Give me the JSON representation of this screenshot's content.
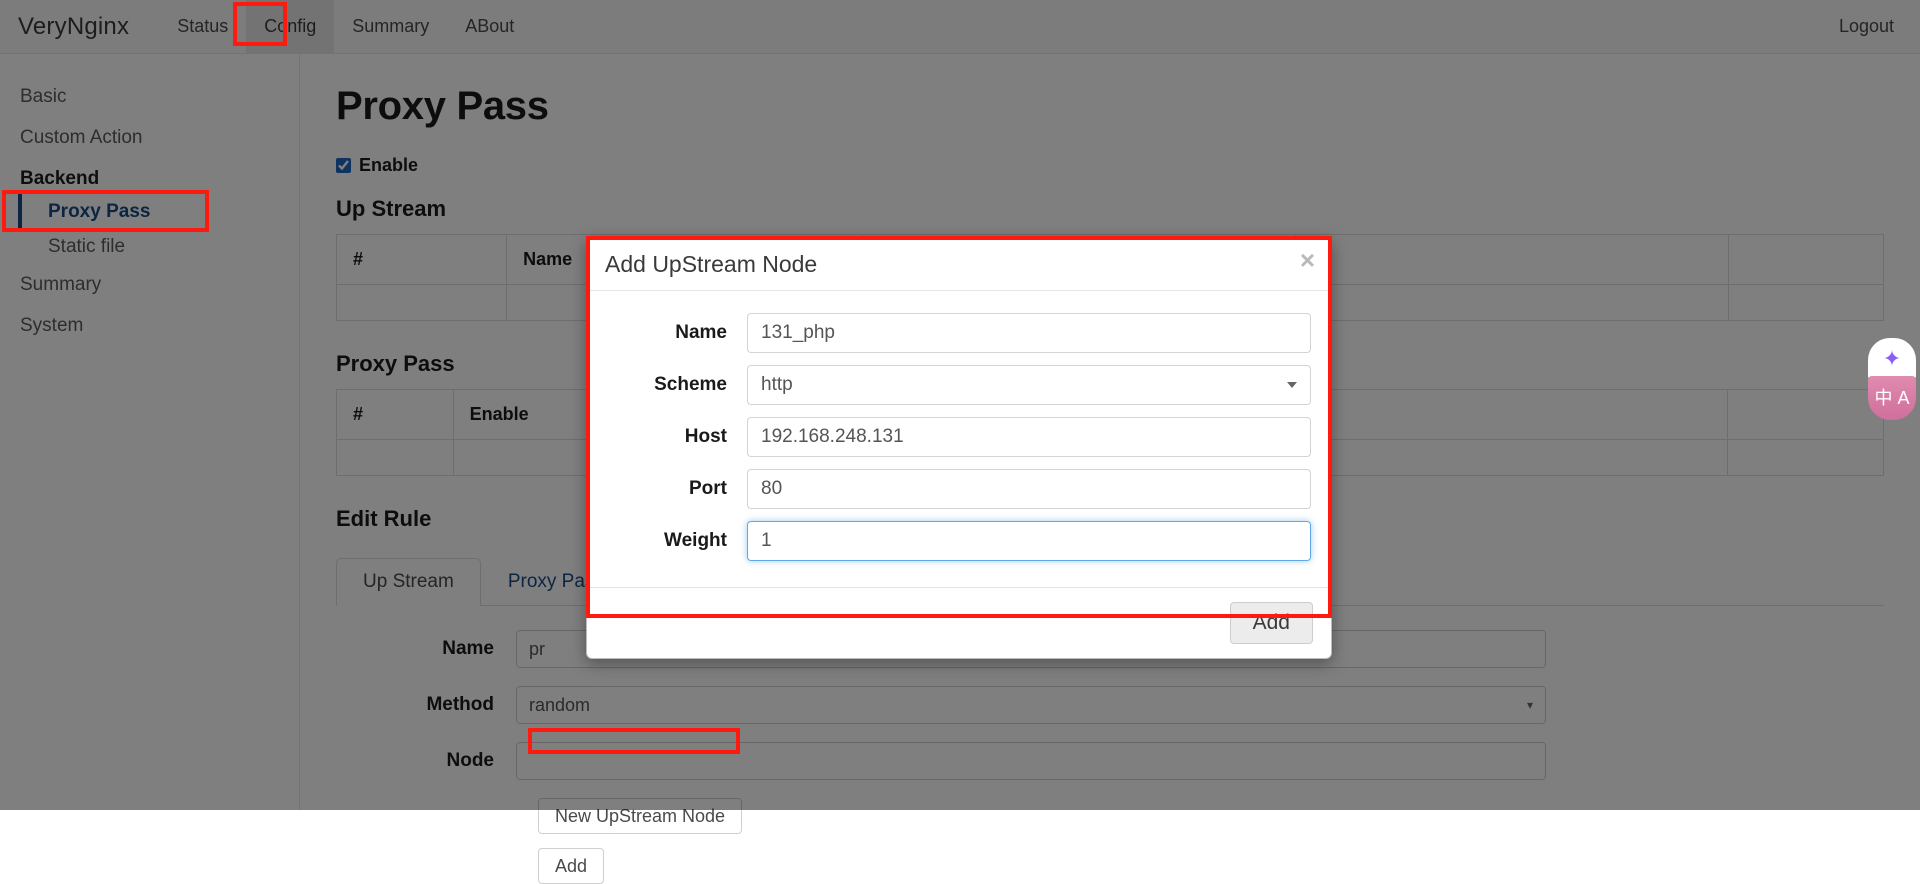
{
  "navbar": {
    "brand": "VeryNginx",
    "links": [
      {
        "label": "Status",
        "active": false
      },
      {
        "label": "Config",
        "active": true
      },
      {
        "label": "Summary",
        "active": false
      },
      {
        "label": "ABout",
        "active": false
      }
    ],
    "logout": "Logout"
  },
  "sidebar": {
    "items": [
      {
        "label": "Basic",
        "type": "item"
      },
      {
        "label": "Custom Action",
        "type": "item"
      },
      {
        "label": "Backend",
        "type": "group"
      },
      {
        "label": "Proxy Pass",
        "type": "sub",
        "current": true
      },
      {
        "label": "Static file",
        "type": "sub",
        "current": false
      },
      {
        "label": "Summary",
        "type": "item"
      },
      {
        "label": "System",
        "type": "item"
      }
    ]
  },
  "main": {
    "title": "Proxy Pass",
    "enable_label": "Enable",
    "enable_checked": true,
    "upstream_section": {
      "heading": "Up Stream",
      "columns": [
        "#",
        "Name",
        "",
        "",
        ""
      ]
    },
    "proxypass_section": {
      "heading": "Proxy Pass",
      "columns": [
        "#",
        "Enable",
        "",
        "",
        ""
      ]
    },
    "editrule_heading": "Edit Rule",
    "tabs": [
      {
        "label": "Up Stream",
        "active": true
      },
      {
        "label": "Proxy Pass",
        "active": false
      }
    ],
    "form": {
      "name_label": "Name",
      "name_value": "pr",
      "method_label": "Method",
      "method_value": "random",
      "node_label": "Node",
      "node_value": "",
      "new_node_button": "New UpStream Node",
      "add_button": "Add"
    }
  },
  "modal": {
    "title": "Add UpStream Node",
    "close_glyph": "×",
    "fields": [
      {
        "label": "Name",
        "value": "131_php",
        "type": "text",
        "focused": false
      },
      {
        "label": "Scheme",
        "value": "http",
        "type": "select",
        "focused": false
      },
      {
        "label": "Host",
        "value": "192.168.248.131",
        "type": "text",
        "focused": false
      },
      {
        "label": "Port",
        "value": "80",
        "type": "text",
        "focused": false
      },
      {
        "label": "Weight",
        "value": "1",
        "type": "text",
        "focused": true
      }
    ],
    "submit_label": "Add"
  },
  "widget": {
    "sparkle_icon": "sparkle-icon",
    "sparkle_glyph": "✦",
    "translate_icon": "translate-icon",
    "translate_glyph": "中 A"
  },
  "colors": {
    "annotation": "#ff1a0f",
    "link": "#1b4b86",
    "accent_focus": "#62a8e8"
  }
}
